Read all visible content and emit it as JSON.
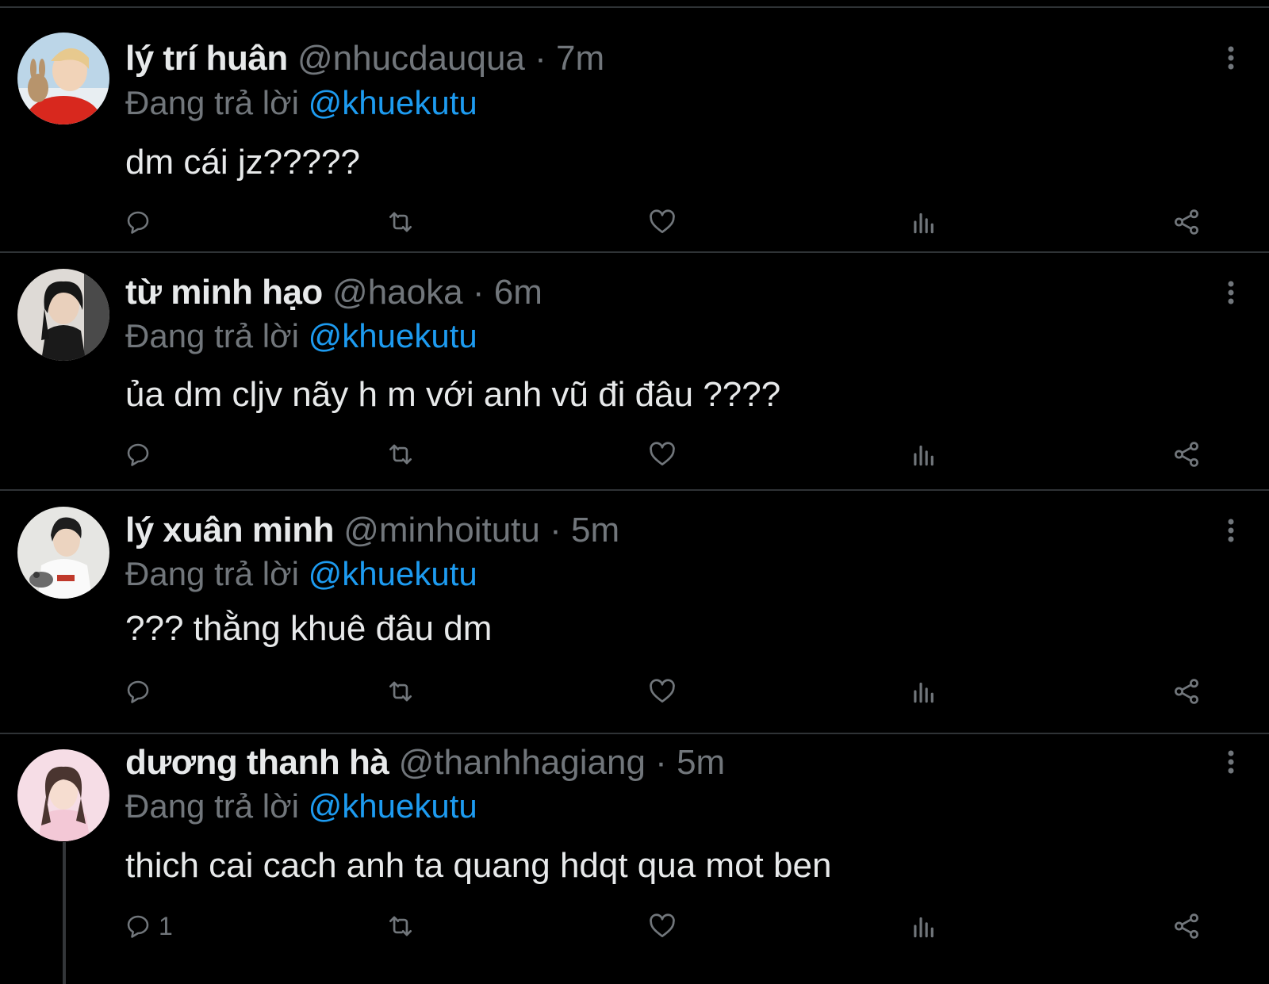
{
  "colors": {
    "background": "#000000",
    "divider": "#2f3336",
    "primary_text": "#e7e9ea",
    "secondary_text": "#71767b",
    "mention": "#1d9bf0"
  },
  "tweets": [
    {
      "display_name": "lý trí huân",
      "handle": "@nhucdauqua",
      "separator": "·",
      "time": "7m",
      "reply_prefix": "Đang trả lời",
      "reply_to": "@khuekutu",
      "text": "dm cái jz?????",
      "reply_count": "",
      "icons": [
        "reply-icon",
        "retweet-icon",
        "like-icon",
        "views-icon",
        "share-icon",
        "more-icon"
      ]
    },
    {
      "display_name": "từ minh hạo",
      "handle": "@haoka",
      "separator": "·",
      "time": "6m",
      "reply_prefix": "Đang trả lời",
      "reply_to": "@khuekutu",
      "text": "ủa dm cljv nãy h m với anh vũ đi đâu ????",
      "reply_count": "",
      "icons": [
        "reply-icon",
        "retweet-icon",
        "like-icon",
        "views-icon",
        "share-icon",
        "more-icon"
      ]
    },
    {
      "display_name": "lý xuân minh",
      "handle": "@minhoitutu",
      "separator": "·",
      "time": "5m",
      "reply_prefix": "Đang trả lời",
      "reply_to": "@khuekutu",
      "text": "??? thằng khuê đâu dm",
      "reply_count": "",
      "icons": [
        "reply-icon",
        "retweet-icon",
        "like-icon",
        "views-icon",
        "share-icon",
        "more-icon"
      ]
    },
    {
      "display_name": "dương thanh hà",
      "handle": "@thanhhagiang",
      "separator": "·",
      "time": "5m",
      "reply_prefix": "Đang trả lời",
      "reply_to": "@khuekutu",
      "text": "thich cai cach anh ta quang hdqt qua mot ben",
      "reply_count": "1",
      "icons": [
        "reply-icon",
        "retweet-icon",
        "like-icon",
        "views-icon",
        "share-icon",
        "more-icon"
      ]
    }
  ]
}
